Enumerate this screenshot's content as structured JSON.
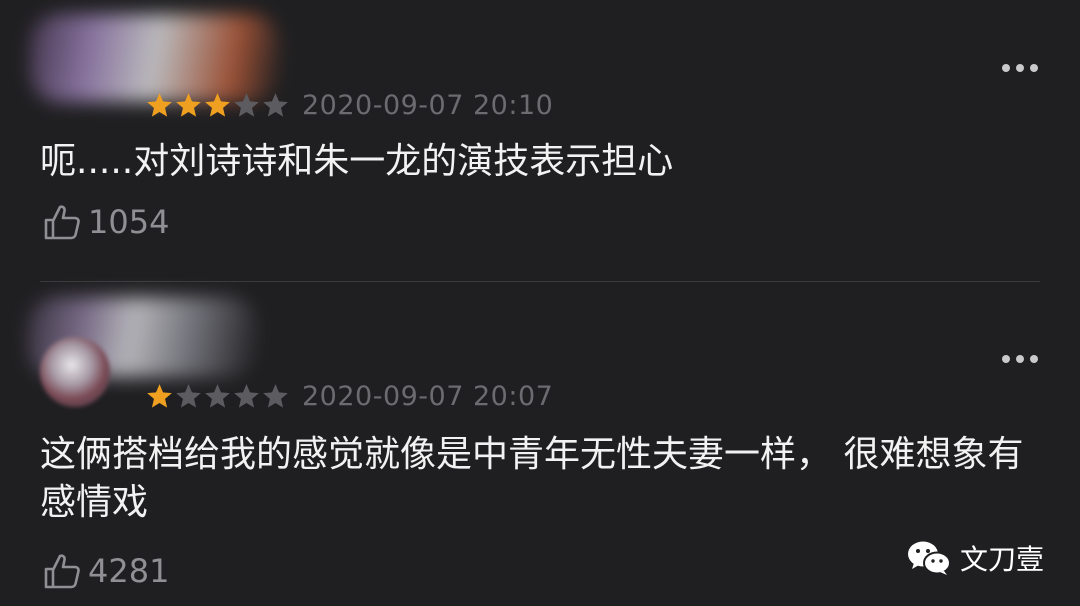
{
  "comments": [
    {
      "rating": 3,
      "max_rating": 5,
      "date": "2020-09-07 20:10",
      "text": "呃.....对刘诗诗和朱一龙的演技表示担心",
      "likes": "1054"
    },
    {
      "rating": 1,
      "max_rating": 5,
      "date": "2020-09-07 20:07",
      "text": "这俩搭档给我的感觉就像是中青年无性夫妻一样， 很难想象有感情戏",
      "likes": "4281"
    }
  ],
  "watermark": {
    "text": "文刀壹",
    "icon": "wechat-icon"
  },
  "icons": {
    "more": "more-dots-icon",
    "like": "thumbs-up-icon",
    "star": "star-icon"
  },
  "colors": {
    "background": "#1f1f21",
    "star_filled": "#f0a020",
    "star_empty": "#5c5c60",
    "date": "#6b6b70",
    "text": "#f2f2f2",
    "likes": "#8f8f94"
  }
}
